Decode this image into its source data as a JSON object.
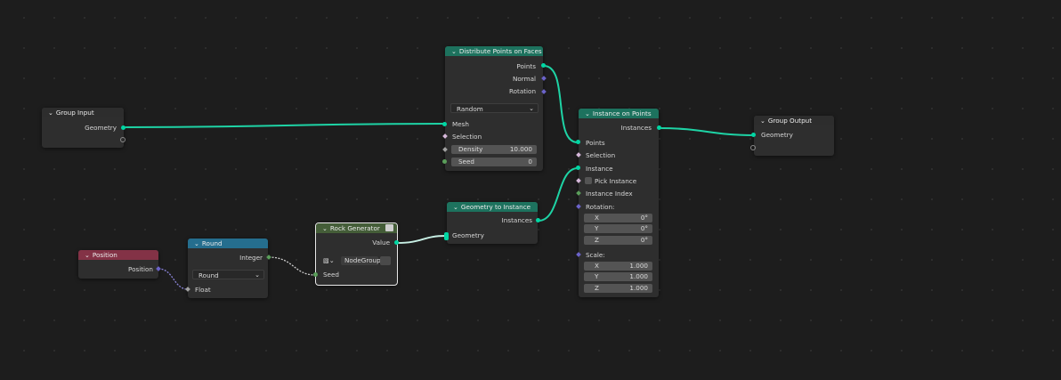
{
  "nodes": {
    "group_input": {
      "title": "Group Input",
      "geometry": "Geometry"
    },
    "distribute": {
      "title": "Distribute Points on Faces",
      "points": "Points",
      "normal": "Normal",
      "rotation": "Rotation",
      "mode": "Random",
      "mesh": "Mesh",
      "selection": "Selection",
      "density_label": "Density",
      "density_value": "10.000",
      "seed_label": "Seed",
      "seed_value": "0"
    },
    "instance_on_points": {
      "title": "Instance on Points",
      "instances": "Instances",
      "points": "Points",
      "selection": "Selection",
      "instance": "Instance",
      "pick_instance": "Pick Instance",
      "instance_index": "Instance Index",
      "rotation": "Rotation:",
      "scale": "Scale:",
      "rot_x": "0°",
      "rot_y": "0°",
      "rot_z": "0°",
      "scale_x": "1.000",
      "scale_y": "1.000",
      "scale_z": "1.000",
      "x": "X",
      "y": "Y",
      "z": "Z"
    },
    "group_output": {
      "title": "Group Output",
      "geometry": "Geometry"
    },
    "geometry_to_instance": {
      "title": "Geometry to Instance",
      "instances": "Instances",
      "geometry": "Geometry"
    },
    "rock_generator": {
      "title": "Rock Generator",
      "value": "Value",
      "datablock": "NodeGroup",
      "seed": "Seed"
    },
    "round": {
      "title": "Round",
      "integer": "Integer",
      "mode": "Round",
      "float": "Float"
    },
    "position": {
      "title": "Position",
      "position": "Position"
    }
  },
  "colors": {
    "geometry_socket": "#00d6a3",
    "integer_socket": "#5a9e5a",
    "vector_socket": "#6b63c9",
    "float_socket": "#a1a1a1",
    "boolean_socket": "#d5b7d9",
    "header_geometry": "#1d725e",
    "header_utility": "#256e8e",
    "header_input": "#833246",
    "header_group": "#445d38"
  }
}
